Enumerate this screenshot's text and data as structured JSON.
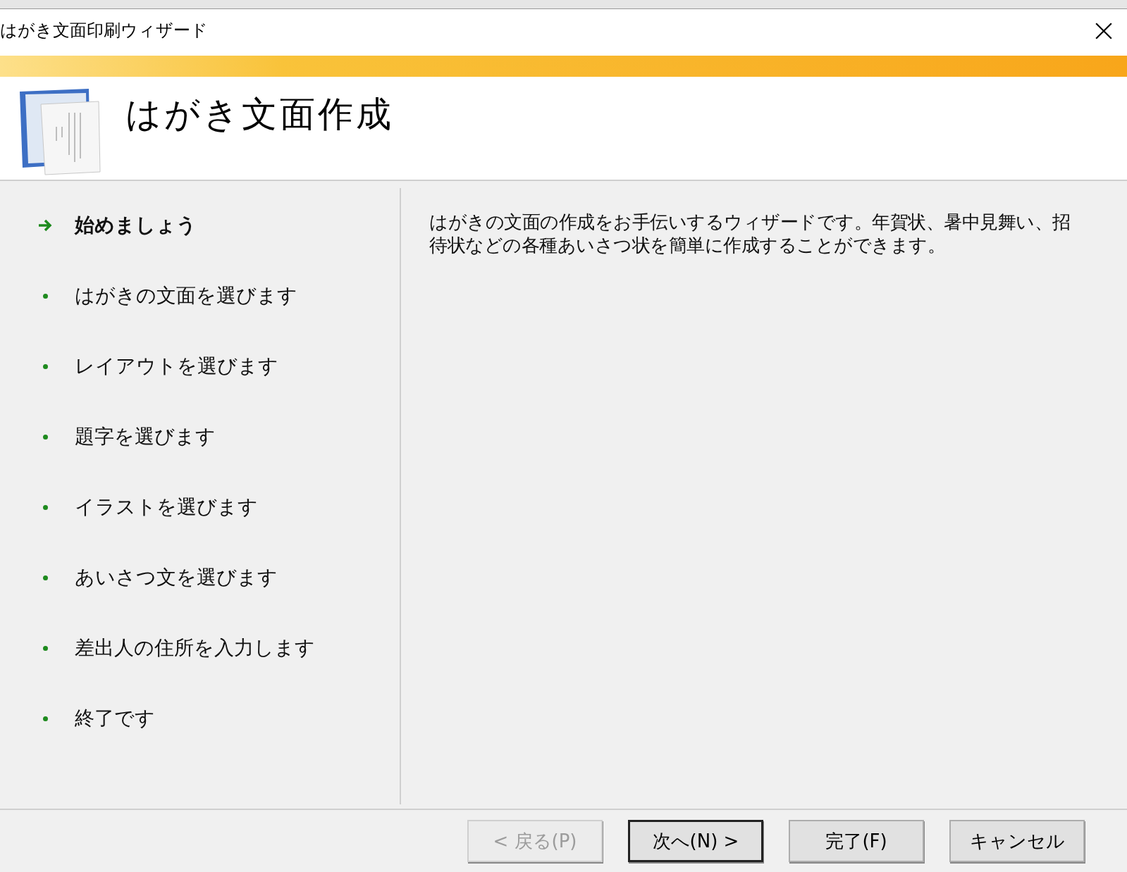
{
  "window": {
    "title": "はがき文面印刷ウィザード"
  },
  "header": {
    "title": "はがき文面作成"
  },
  "steps": [
    {
      "label": "始めましょう",
      "selected": true
    },
    {
      "label": "はがきの文面を選びます",
      "selected": false
    },
    {
      "label": "レイアウトを選びます",
      "selected": false
    },
    {
      "label": "題字を選びます",
      "selected": false
    },
    {
      "label": "イラストを選びます",
      "selected": false
    },
    {
      "label": "あいさつ文を選びます",
      "selected": false
    },
    {
      "label": "差出人の住所を入力します",
      "selected": false
    },
    {
      "label": "終了です",
      "selected": false
    }
  ],
  "description": "はがきの文面の作成をお手伝いするウィザードです。年賀状、暑中見舞い、招待状などの各種あいさつ状を簡単に作成することができます。",
  "buttons": [
    {
      "label": "< 戻る(P)",
      "disabled": true,
      "default": false
    },
    {
      "label": "次へ(N) >",
      "disabled": false,
      "default": true
    },
    {
      "label": "完了(F)",
      "disabled": false,
      "default": false
    },
    {
      "label": "キャンセル",
      "disabled": false,
      "default": false
    }
  ]
}
